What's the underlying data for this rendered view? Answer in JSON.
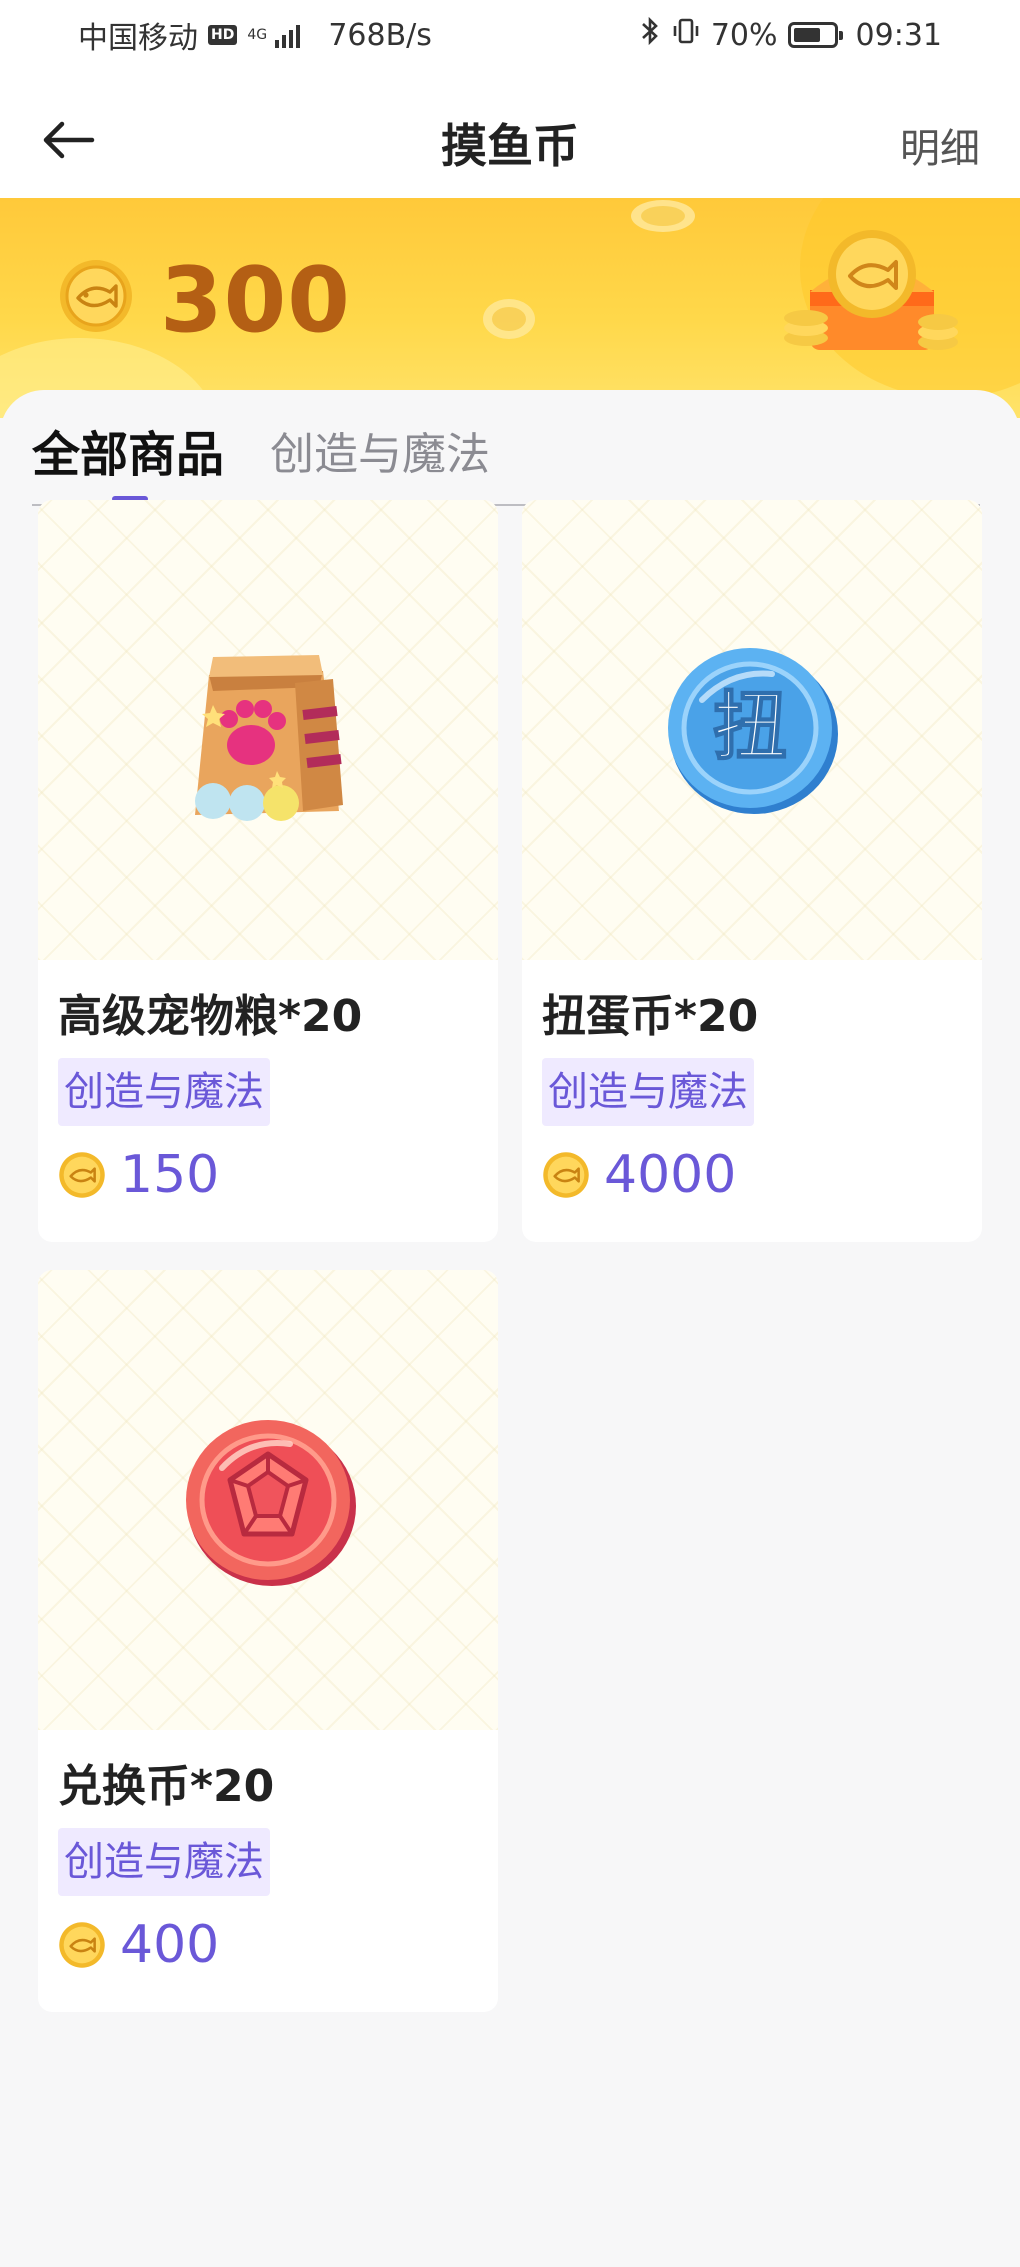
{
  "status_bar": {
    "carrier": "中国移动",
    "hd_badge": "HD",
    "network": "4G",
    "speed": "768B/s",
    "battery_percent": "70%",
    "battery_level": 0.7,
    "time": "09:31"
  },
  "header": {
    "title": "摸鱼币",
    "detail_label": "明细"
  },
  "balance": {
    "amount": "300"
  },
  "tabs": [
    {
      "label": "全部商品",
      "active": true
    },
    {
      "label": "创造与魔法",
      "active": false
    }
  ],
  "products": [
    {
      "title": "高级宠物粮*20",
      "tag": "创造与魔法",
      "price": "150",
      "icon": "pet-food-bag-icon"
    },
    {
      "title": "扭蛋币*20",
      "tag": "创造与魔法",
      "price": "4000",
      "icon": "gacha-coin-icon",
      "coin_char": "扭"
    },
    {
      "title": "兑换币*20",
      "tag": "创造与魔法",
      "price": "400",
      "icon": "exchange-coin-icon"
    }
  ],
  "colors": {
    "accent": "#6a58d8",
    "banner": "#ffd84a",
    "balance_text": "#b45f14",
    "tag_bg": "#efeaff"
  }
}
